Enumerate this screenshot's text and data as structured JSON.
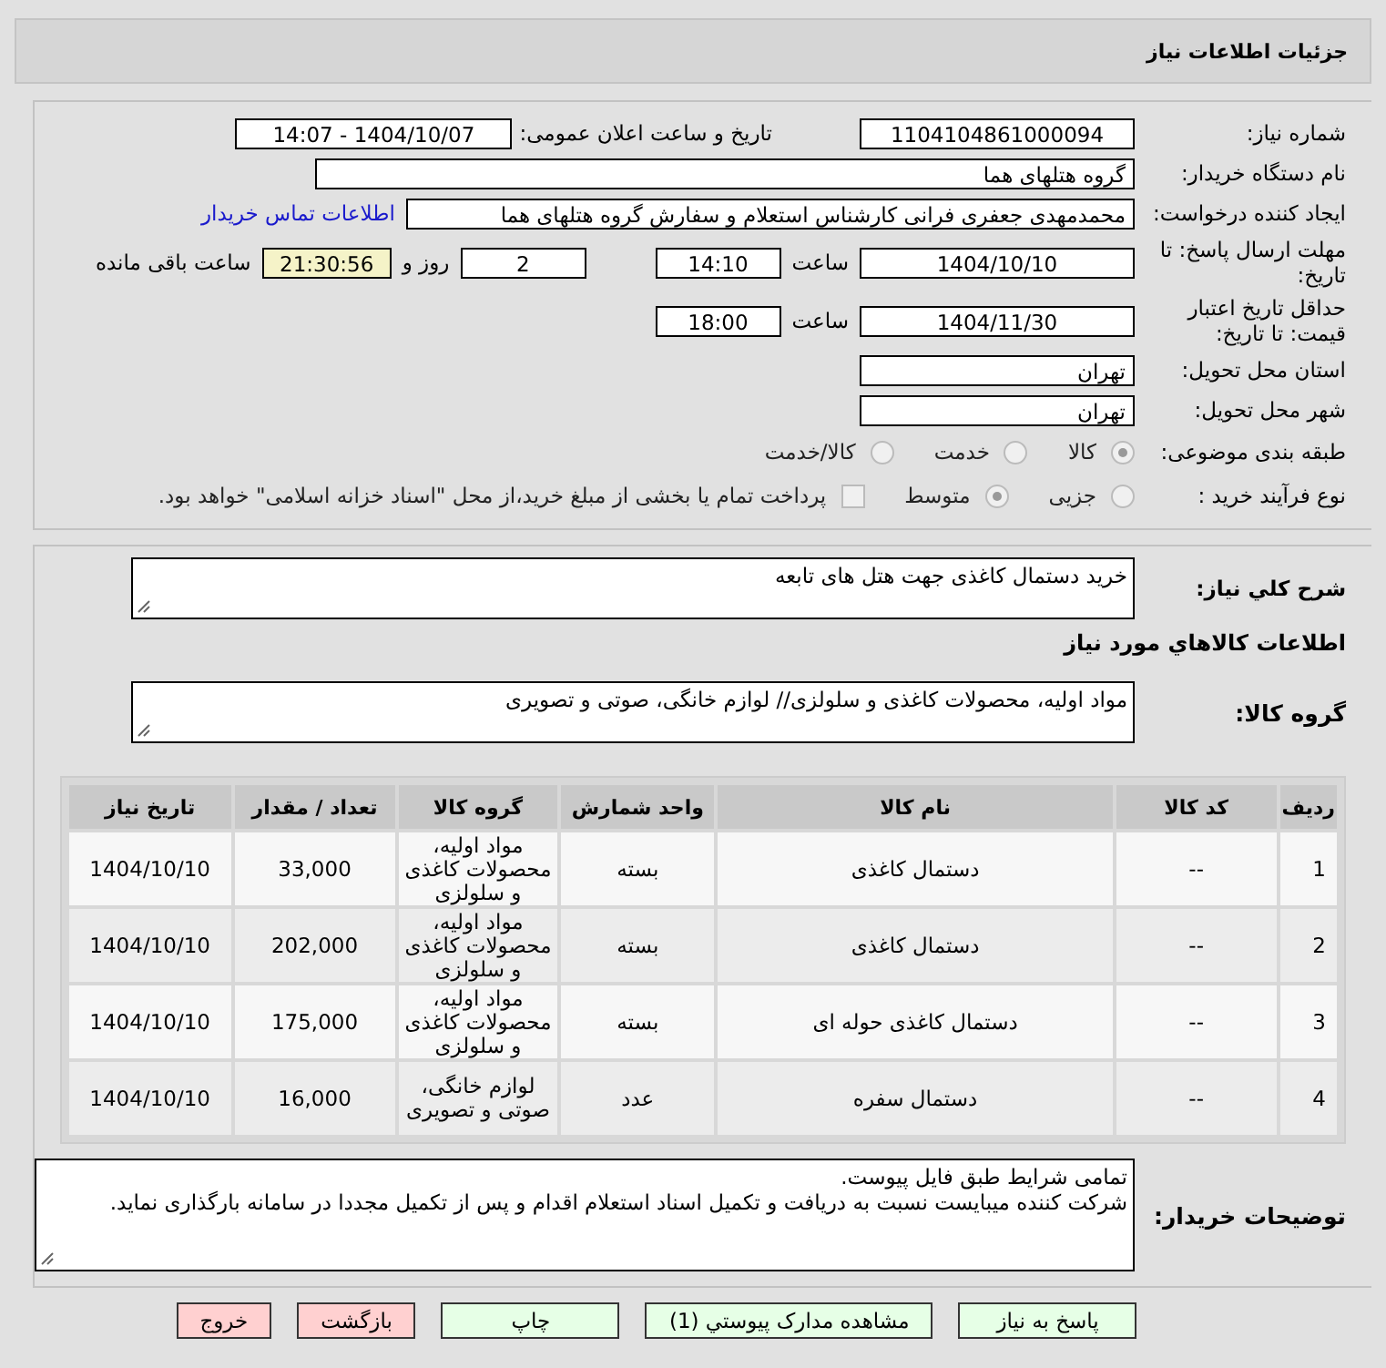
{
  "header": {
    "title": "جزئیات اطلاعات نیاز"
  },
  "need_number": {
    "label": "شماره نیاز:",
    "value": "1104104861000094"
  },
  "announce": {
    "label": "تاریخ و ساعت اعلان عمومی:",
    "value": "1404/10/07 - 14:07"
  },
  "buyer": {
    "label": "نام دستگاه خریدار:",
    "value": "گروه هتلهای هما"
  },
  "requester": {
    "label": "ایجاد کننده درخواست:",
    "value": "محمدمهدی جعفری فرانی کارشناس استعلام و سفارش گروه هتلهای هما",
    "link": "اطلاعات تماس خریدار"
  },
  "deadline": {
    "label": "مهلت ارسال پاسخ: تا تاریخ:",
    "date": "1404/10/10",
    "time_label": "ساعت",
    "time": "14:10",
    "days": "2",
    "days_label": "روز و",
    "remaining": "21:30:56",
    "remaining_label": "ساعت باقی مانده"
  },
  "validity": {
    "label": "حداقل تاریخ اعتبار قیمت: تا تاریخ:",
    "date": "1404/11/30",
    "time_label": "ساعت",
    "time": "18:00"
  },
  "province": {
    "label": "استان محل تحویل:",
    "value": "تهران"
  },
  "city": {
    "label": "شهر محل تحویل:",
    "value": "تهران"
  },
  "category": {
    "label": "طبقه بندی موضوعی:",
    "options": [
      {
        "label": "کالا",
        "selected": true
      },
      {
        "label": "خدمت",
        "selected": false
      },
      {
        "label": "کالا/خدمت",
        "selected": false
      }
    ]
  },
  "process": {
    "label": "نوع فرآیند خرید :",
    "options": [
      {
        "label": "جزیی",
        "selected": false
      },
      {
        "label": "متوسط",
        "selected": true
      }
    ],
    "payment": {
      "checked": false,
      "text": "پرداخت تمام یا بخشی از مبلغ خرید،از محل \"اسناد خزانه اسلامی\" خواهد بود."
    }
  },
  "description": {
    "label": "شرح کلي نیاز:",
    "value": "خرید دستمال کاغذی جهت هتل های تابعه"
  },
  "goods_title": "اطلاعات کالاهاي مورد نیاز",
  "goods_group": {
    "label": "گروه کالا:",
    "value": "مواد اولیه، محصولات کاغذی و سلولزی// لوازم خانگی، صوتی و تصویری"
  },
  "table": {
    "columns": [
      "ردیف",
      "کد کالا",
      "نام کالا",
      "واحد شمارش",
      "گروه کالا",
      "تعداد / مقدار",
      "تاریخ نیاز"
    ],
    "rows": [
      [
        "1",
        "--",
        "دستمال کاغذی",
        "بسته",
        "مواد اولیه، محصولات کاغذی و سلولزی",
        "33,000",
        "1404/10/10"
      ],
      [
        "2",
        "--",
        "دستمال کاغذی",
        "بسته",
        "مواد اولیه، محصولات کاغذی و سلولزی",
        "202,000",
        "1404/10/10"
      ],
      [
        "3",
        "--",
        "دستمال کاغذی حوله ای",
        "بسته",
        "مواد اولیه، محصولات کاغذی و سلولزی",
        "175,000",
        "1404/10/10"
      ],
      [
        "4",
        "--",
        "دستمال سفره",
        "عدد",
        "لوازم خانگی، صوتی و تصویری",
        "16,000",
        "1404/10/10"
      ]
    ]
  },
  "notes": {
    "label": "توضیحات خریدار:",
    "lines": [
      "تمامی شرایط طبق فایل پیوست.",
      "شرکت کننده میبایست نسبت به دریافت و تکمیل اسناد استعلام اقدام و پس از تکمیل مجددا در سامانه بارگذاری نماید."
    ]
  },
  "buttons": [
    {
      "label": "پاسخ به نیاز",
      "kind": "action"
    },
    {
      "label": "مشاهده مدارک پیوستي (1)",
      "kind": "action"
    },
    {
      "label": "چاپ",
      "kind": "action"
    },
    {
      "label": "بازگشت",
      "kind": "danger"
    },
    {
      "label": "خروج",
      "kind": "danger"
    }
  ]
}
